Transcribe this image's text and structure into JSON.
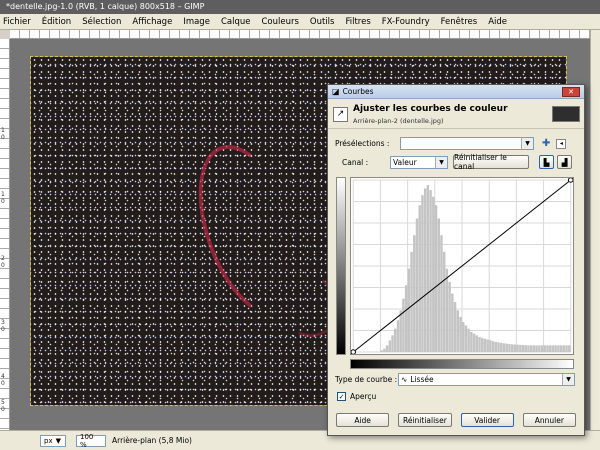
{
  "window": {
    "title": "*dentelle.jpg-1.0 (RVB, 1 calque) 800x518 – GIMP"
  },
  "menubar": {
    "items": [
      "Fichier",
      "Édition",
      "Sélection",
      "Affichage",
      "Image",
      "Calque",
      "Couleurs",
      "Outils",
      "Filtres",
      "FX-Foundry",
      "Fenêtres",
      "Aide"
    ]
  },
  "rulers": {
    "left_labels": [
      "1",
      "0",
      "1",
      "0",
      "2",
      "0",
      "3",
      "0",
      "4",
      "0",
      "5",
      "0"
    ]
  },
  "statusbar": {
    "unit": "px",
    "zoom": "100 %",
    "layer_info": "Arrière-plan (5,8 Mio)"
  },
  "dialog": {
    "title": "Courbes",
    "close_label": "✕",
    "header_title": "Ajuster les courbes de couleur",
    "header_subtitle": "Arrière-plan-2 (dentelle.jpg)",
    "presets_label": "Présélections :",
    "presets_value": "",
    "channel_label": "Canal :",
    "channel_value": "Valeur",
    "reset_channel_label": "Réinitialiser le canal",
    "curve_type_label": "Type de courbe :",
    "curve_type_value": "Lissée",
    "preview_label": "Aperçu",
    "preview_checked": true,
    "buttons": {
      "help": "Aide",
      "reset": "Réinitialiser",
      "ok": "Valider",
      "cancel": "Annuler"
    }
  },
  "chart_data": {
    "type": "bar",
    "title": "",
    "xlabel": "",
    "ylabel": "",
    "xlim": [
      0,
      255
    ],
    "ylim": [
      0,
      1
    ],
    "grid": true,
    "histogram_bins": [
      0,
      0,
      0,
      0,
      0,
      0,
      0,
      0,
      0,
      0,
      0.01,
      0.02,
      0.04,
      0.07,
      0.1,
      0.14,
      0.19,
      0.25,
      0.32,
      0.4,
      0.5,
      0.6,
      0.7,
      0.8,
      0.88,
      0.94,
      0.98,
      1.0,
      0.97,
      0.93,
      0.88,
      0.8,
      0.7,
      0.6,
      0.5,
      0.42,
      0.35,
      0.3,
      0.25,
      0.21,
      0.18,
      0.16,
      0.14,
      0.12,
      0.11,
      0.1,
      0.09,
      0.085,
      0.08,
      0.075,
      0.07,
      0.065,
      0.06,
      0.058,
      0.055,
      0.052,
      0.05,
      0.048,
      0.046,
      0.045,
      0.044,
      0.043,
      0.042,
      0.041,
      0.04,
      0.04,
      0.04,
      0.04,
      0.04,
      0.04,
      0.04,
      0.04,
      0.04,
      0.04,
      0.04,
      0.04,
      0.04,
      0.04,
      0.04,
      0.04
    ],
    "curve_points": [
      [
        0,
        0
      ],
      [
        255,
        255
      ]
    ]
  }
}
